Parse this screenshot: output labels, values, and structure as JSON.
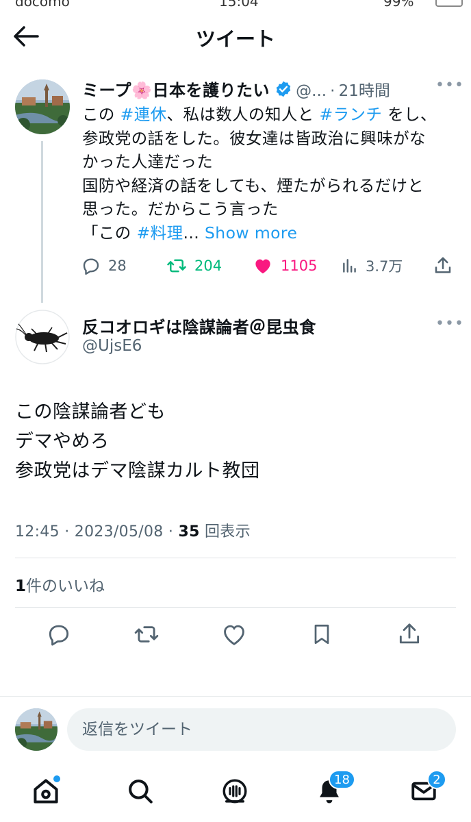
{
  "status_bar": {
    "carrier": "docomo",
    "time": "15:04",
    "battery": "99%"
  },
  "header": {
    "title": "ツイート"
  },
  "tweet1": {
    "author": "ミープ🌸日本を護りたい",
    "handle": "@...",
    "sep": "·",
    "time": "21時間",
    "lines": [
      [
        {
          "t": "この "
        },
        {
          "t": "#連休",
          "hl": true
        },
        {
          "t": "、私は数人の知人と "
        },
        {
          "t": "#ランチ",
          "hl": true
        },
        {
          "t": " をし、"
        }
      ],
      [
        {
          "t": "参政党の話をした。彼女達は皆政治に興味がな"
        }
      ],
      [
        {
          "t": "かった人達だった"
        }
      ],
      [
        {
          "t": "国防や経済の話をしても、煙たがられるだけと"
        }
      ],
      [
        {
          "t": "思った。だからこう言った"
        }
      ],
      [
        {
          "t": "「この "
        },
        {
          "t": "#料理",
          "hl": true
        },
        {
          "t": "... "
        },
        {
          "t": "Show more",
          "hl": true
        }
      ]
    ],
    "replies": "28",
    "retweets": "204",
    "likes": "1105",
    "views": "3.7万",
    "colors": {
      "retweet": "#00ba7c",
      "like": "#f91880",
      "link": "#1d9bf0"
    }
  },
  "tweet2": {
    "author": "反コオロギは陰謀論者＠昆虫食",
    "handle": "@UjsE6",
    "text_lines": [
      "この陰謀論者ども",
      "デマやめろ",
      "参政党はデマ陰謀カルト教団"
    ],
    "meta_time": "12:45 · 2023/05/08 · ",
    "meta_views_count": "35",
    "meta_views_label": " 回表示",
    "likes_count": "1",
    "likes_label": "件のいいね"
  },
  "reply": {
    "placeholder": "返信をツイート"
  },
  "tabbar": {
    "notifications_badge": "18",
    "messages_badge": "2"
  },
  "icons": [
    "back-arrow-icon",
    "verified-icon",
    "more-icon",
    "reply-icon",
    "retweet-icon",
    "heart-icon",
    "views-icon",
    "share-icon",
    "bookmark-icon",
    "home-icon",
    "search-icon",
    "spaces-icon",
    "bell-icon",
    "mail-icon"
  ]
}
